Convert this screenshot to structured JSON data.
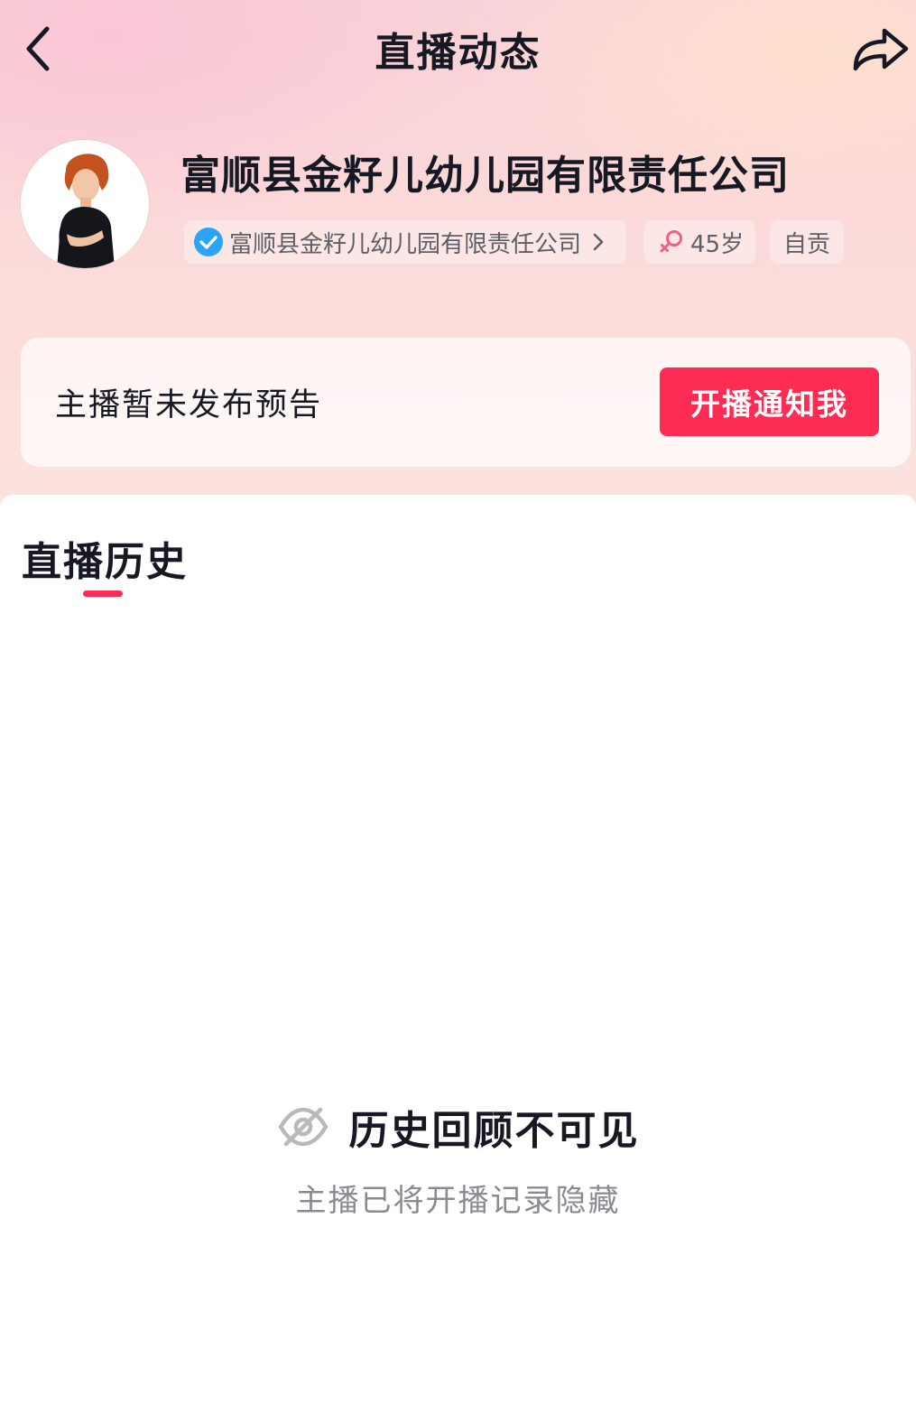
{
  "header": {
    "title": "直播动态"
  },
  "profile": {
    "name": "富顺县金籽儿幼儿园有限责任公司",
    "verified_label": "富顺县金籽儿幼儿园有限责任公司",
    "age": "45岁",
    "location": "自贡"
  },
  "notice": {
    "text": "主播暂未发布预告",
    "button_label": "开播通知我"
  },
  "tabs": [
    {
      "label": "直播历史",
      "active": true
    }
  ],
  "empty_state": {
    "title": "历史回顾不可见",
    "subtitle": "主播已将开播记录隐藏"
  },
  "colors": {
    "accent": "#fe2c55",
    "verified": "#2aa4f4",
    "female": "#f0607f"
  },
  "icons": {
    "back": "chevron-left-icon",
    "share": "share-arrow-icon",
    "verified": "verified-check-icon",
    "gender": "female-icon",
    "hidden": "hidden-eye-icon"
  }
}
